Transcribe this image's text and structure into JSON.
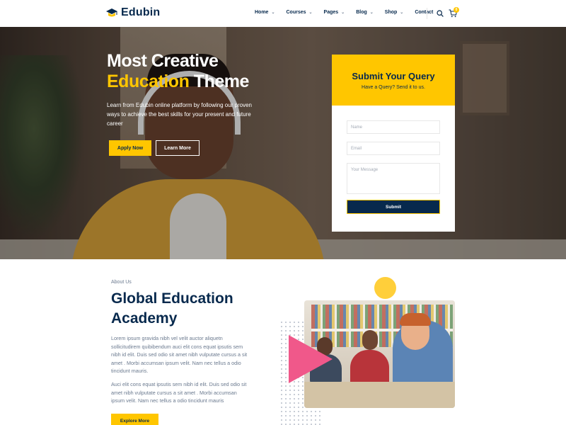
{
  "header": {
    "logo_text": "Edubin",
    "nav": [
      {
        "label": "Home"
      },
      {
        "label": "Courses"
      },
      {
        "label": "Pages"
      },
      {
        "label": "Blog"
      },
      {
        "label": "Shop"
      },
      {
        "label": "Contact"
      }
    ],
    "cart_count": "0"
  },
  "hero": {
    "title_line1": "Most Creative",
    "title_accent": "Education",
    "title_rest": "Theme",
    "description": "Learn from Edubin online platform by following our proven ways to achieve the best skills for your present and future career",
    "apply_label": "Apply Now",
    "learn_label": "Learn More"
  },
  "query": {
    "title": "Submit Your Query",
    "subtitle": "Have a Query? Send it to us.",
    "name_placeholder": "Name",
    "email_placeholder": "Email",
    "message_placeholder": "Your Message",
    "submit_label": "Submit"
  },
  "about": {
    "kicker": "About Us",
    "title": "Global Education Academy",
    "paragraph1": "Lorem ipsum gravida nibh vel velit auctor aliquetn sollicitudirem quibibendum auci elit cons equat ipsutis sem nibh id elit. Duis sed odio sit amet nibh vulputate cursus a sit amet . Morbi accumsan ipsum velit. Nam nec tellus a odio tincidunt mauris.",
    "paragraph2": "Auci elit cons equat ipsutis sem nibh id elit. Duis sed odio sit amet nibh vulputate cursus a sit amet . Morbi accumsan ipsum velit. Nam nec tellus a odio tincidunt mauris",
    "explore_label": "Explore More"
  },
  "colors": {
    "accent": "#ffc600",
    "navy": "#07294d",
    "pink": "#f0588a"
  }
}
